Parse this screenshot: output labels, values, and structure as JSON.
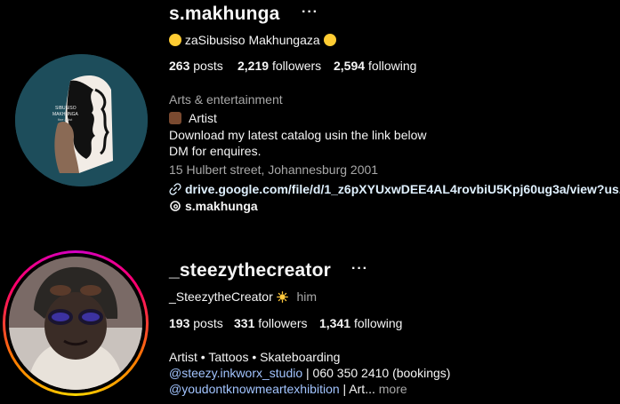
{
  "profile1": {
    "username": "s.makhunga",
    "more_icon": "ellipsis-icon",
    "full_name": "zaSibusiso Makhungaza",
    "stats": {
      "posts_count": "263",
      "posts_label": "posts",
      "followers_count": "2,219",
      "followers_label": "followers",
      "following_count": "2,594",
      "following_label": "following"
    },
    "category": "Arts & entertainment",
    "bio_line1": "Artist",
    "bio_line2": "Download my latest catalog usin the link below",
    "bio_line3": "DM for enquires.",
    "address": "15 Hulbert street, Johannesburg 2001",
    "link_text": "drive.google.com/file/d/1_z6pXYUxwDEE4AL4rovbiU5Kpj60ug3a/view?us...",
    "threads_handle": "s.makhunga",
    "avatar_text": [
      "SIBUSISO",
      "MAKHUNGA",
      "fine artist"
    ]
  },
  "profile2": {
    "username": "_steezythecreator",
    "more_icon": "ellipsis-icon",
    "full_name": "_SteezytheCreator",
    "pronouns": "him",
    "stats": {
      "posts_count": "193",
      "posts_label": "posts",
      "followers_count": "331",
      "followers_label": "followers",
      "following_count": "1,341",
      "following_label": "following"
    },
    "bio_line1": "Artist • Tattoos • Skateboarding",
    "mention1": "@steezy.inkworx_studio",
    "bio_line2_rest": " | 060 350 2410 (bookings)",
    "mention2": "@youdontknowmeartexhibition",
    "bio_line3_rest": " | Art...",
    "more_label": "more"
  },
  "colors": {
    "background": "#000000",
    "link": "#e0f1ff",
    "mention": "#a2c4ff",
    "muted": "#a8a8a8",
    "avatar1_bg": "#1d4d5b"
  }
}
